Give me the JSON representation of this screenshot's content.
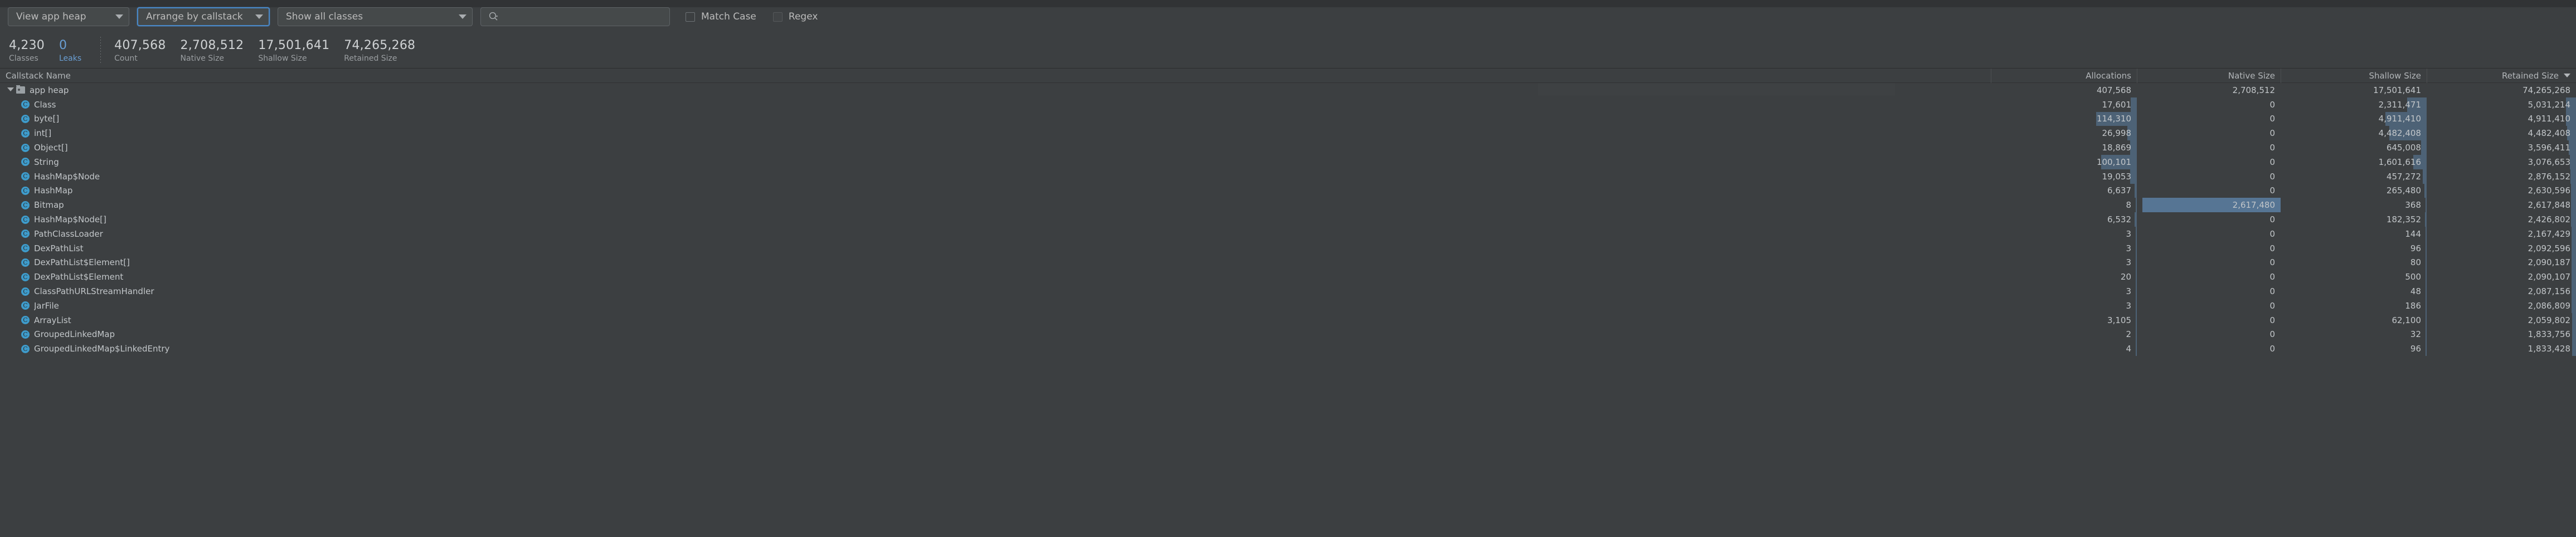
{
  "toolbar": {
    "heap_select": {
      "label": "View app heap",
      "icon": "chevron-down-icon"
    },
    "arrange_select": {
      "label": "Arrange by callstack",
      "icon": "chevron-down-icon",
      "focused": true
    },
    "class_filter_select": {
      "label": "Show all classes",
      "icon": "chevron-down-icon"
    },
    "search": {
      "value": "",
      "placeholder": "",
      "icon": "search-icon"
    },
    "match_case": {
      "label": "Match Case",
      "checked": false
    },
    "regex": {
      "label": "Regex",
      "checked": false
    }
  },
  "stats": {
    "classes": {
      "value": "4,230",
      "label": "Classes"
    },
    "leaks": {
      "value": "0",
      "label": "Leaks"
    },
    "count": {
      "value": "407,568",
      "label": "Count"
    },
    "native_size": {
      "value": "2,708,512",
      "label": "Native Size"
    },
    "shallow_size": {
      "value": "17,501,641",
      "label": "Shallow Size"
    },
    "retained_size": {
      "value": "74,265,268",
      "label": "Retained Size"
    }
  },
  "table": {
    "columns": {
      "name": "Callstack Name",
      "allocations": "Allocations",
      "native": "Native Size",
      "shallow": "Shallow Size",
      "retained": "Retained Size"
    },
    "sort": {
      "column": "Retained Size",
      "direction": "desc",
      "icon": "caret-down-icon"
    },
    "max": {
      "allocations": 407568,
      "native": 2708512,
      "shallow": 17501641,
      "retained": 74265268
    },
    "rows": [
      {
        "name": "app heap",
        "icon": "folder-icon",
        "depth": 0,
        "expanded": true,
        "allocations": "407,568",
        "native": "2,708,512",
        "shallow": "17,501,641",
        "retained": "74,265,268",
        "a": 407568,
        "n": 2708512,
        "s": 17501641,
        "r": 74265268
      },
      {
        "name": "Class",
        "icon": "class-icon",
        "depth": 1,
        "allocations": "17,601",
        "native": "0",
        "shallow": "2,311,471",
        "retained": "5,031,214",
        "a": 17601,
        "n": 0,
        "s": 2311471,
        "r": 5031214
      },
      {
        "name": "byte[]",
        "icon": "class-icon",
        "depth": 1,
        "allocations": "114,310",
        "native": "0",
        "shallow": "4,911,410",
        "retained": "4,911,410",
        "a": 114310,
        "n": 0,
        "s": 4911410,
        "r": 4911410
      },
      {
        "name": "int[]",
        "icon": "class-icon",
        "depth": 1,
        "allocations": "26,998",
        "native": "0",
        "shallow": "4,482,408",
        "retained": "4,482,408",
        "a": 26998,
        "n": 0,
        "s": 4482408,
        "r": 4482408
      },
      {
        "name": "Object[]",
        "icon": "class-icon",
        "depth": 1,
        "allocations": "18,869",
        "native": "0",
        "shallow": "645,008",
        "retained": "3,596,411",
        "a": 18869,
        "n": 0,
        "s": 645008,
        "r": 3596411
      },
      {
        "name": "String",
        "icon": "class-icon",
        "depth": 1,
        "allocations": "100,101",
        "native": "0",
        "shallow": "1,601,616",
        "retained": "3,076,653",
        "a": 100101,
        "n": 0,
        "s": 1601616,
        "r": 3076653
      },
      {
        "name": "HashMap$Node",
        "icon": "class-icon",
        "depth": 1,
        "allocations": "19,053",
        "native": "0",
        "shallow": "457,272",
        "retained": "2,876,152",
        "a": 19053,
        "n": 0,
        "s": 457272,
        "r": 2876152
      },
      {
        "name": "HashMap",
        "icon": "class-icon",
        "depth": 1,
        "allocations": "6,637",
        "native": "0",
        "shallow": "265,480",
        "retained": "2,630,596",
        "a": 6637,
        "n": 0,
        "s": 265480,
        "r": 2630596
      },
      {
        "name": "Bitmap",
        "icon": "class-icon",
        "depth": 1,
        "native_highlight": true,
        "allocations": "8",
        "native": "2,617,480",
        "shallow": "368",
        "retained": "2,617,848",
        "a": 8,
        "n": 2617480,
        "s": 368,
        "r": 2617848
      },
      {
        "name": "HashMap$Node[]",
        "icon": "class-icon",
        "depth": 1,
        "allocations": "6,532",
        "native": "0",
        "shallow": "182,352",
        "retained": "2,426,802",
        "a": 6532,
        "n": 0,
        "s": 182352,
        "r": 2426802
      },
      {
        "name": "PathClassLoader",
        "icon": "class-icon",
        "depth": 1,
        "allocations": "3",
        "native": "0",
        "shallow": "144",
        "retained": "2,167,429",
        "a": 3,
        "n": 0,
        "s": 144,
        "r": 2167429
      },
      {
        "name": "DexPathList",
        "icon": "class-icon",
        "depth": 1,
        "allocations": "3",
        "native": "0",
        "shallow": "96",
        "retained": "2,092,596",
        "a": 3,
        "n": 0,
        "s": 96,
        "r": 2092596
      },
      {
        "name": "DexPathList$Element[]",
        "icon": "class-icon",
        "depth": 1,
        "allocations": "3",
        "native": "0",
        "shallow": "80",
        "retained": "2,090,187",
        "a": 3,
        "n": 0,
        "s": 80,
        "r": 2090187
      },
      {
        "name": "DexPathList$Element",
        "icon": "class-icon",
        "depth": 1,
        "allocations": "20",
        "native": "0",
        "shallow": "500",
        "retained": "2,090,107",
        "a": 20,
        "n": 0,
        "s": 500,
        "r": 2090107
      },
      {
        "name": "ClassPathURLStreamHandler",
        "icon": "class-icon",
        "depth": 1,
        "allocations": "3",
        "native": "0",
        "shallow": "48",
        "retained": "2,087,156",
        "a": 3,
        "n": 0,
        "s": 48,
        "r": 2087156
      },
      {
        "name": "JarFile",
        "icon": "class-icon",
        "depth": 1,
        "allocations": "3",
        "native": "0",
        "shallow": "186",
        "retained": "2,086,809",
        "a": 3,
        "n": 0,
        "s": 186,
        "r": 2086809
      },
      {
        "name": "ArrayList",
        "icon": "class-icon",
        "depth": 1,
        "allocations": "3,105",
        "native": "0",
        "shallow": "62,100",
        "retained": "2,059,802",
        "a": 3105,
        "n": 0,
        "s": 62100,
        "r": 2059802
      },
      {
        "name": "GroupedLinkedMap",
        "icon": "class-icon",
        "depth": 1,
        "allocations": "2",
        "native": "0",
        "shallow": "32",
        "retained": "1,833,756",
        "a": 2,
        "n": 0,
        "s": 32,
        "r": 1833756
      },
      {
        "name": "GroupedLinkedMap$LinkedEntry",
        "icon": "class-icon",
        "depth": 1,
        "allocations": "4",
        "native": "0",
        "shallow": "96",
        "retained": "1,833,428",
        "a": 4,
        "n": 0,
        "s": 96,
        "r": 1833428
      }
    ]
  },
  "colors": {
    "background": "#3c3f41",
    "bar": "#5b7fa3",
    "accent": "#4a88c7",
    "class_icon": "#3e9ccc",
    "leaks_text": "#6a9fd4"
  }
}
